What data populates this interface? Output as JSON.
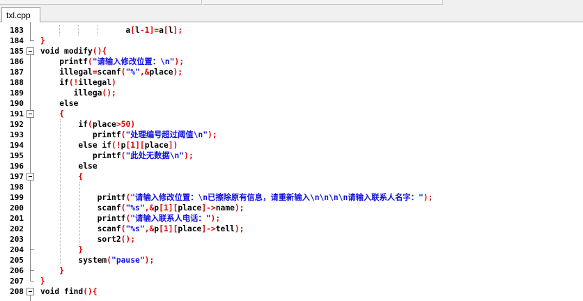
{
  "tab": {
    "label": "txl.cpp"
  },
  "lines": [
    {
      "n": "183",
      "parts": [
        [
          "",
          "                  a"
        ],
        [
          "op",
          "["
        ],
        [
          "",
          "l"
        ],
        [
          "op",
          "-"
        ],
        [
          "num",
          "1"
        ],
        [
          "op",
          "]="
        ],
        [
          "",
          "a"
        ],
        [
          "op",
          "["
        ],
        [
          "",
          "l"
        ],
        [
          "op",
          "];"
        ]
      ]
    },
    {
      "n": "184",
      "parts": [
        [
          "br",
          "}"
        ]
      ]
    },
    {
      "n": "185",
      "parts": [
        [
          "kw",
          "void "
        ],
        [
          "",
          "modify"
        ],
        [
          "op",
          "(){"
        ]
      ]
    },
    {
      "n": "186",
      "parts": [
        [
          "",
          "    printf"
        ],
        [
          "op",
          "("
        ],
        [
          "str",
          "\"请输入修改位置：\\n\""
        ],
        [
          "op",
          ");"
        ]
      ]
    },
    {
      "n": "187",
      "parts": [
        [
          "",
          "    illegal"
        ],
        [
          "op",
          "="
        ],
        [
          "",
          "scanf"
        ],
        [
          "op",
          "("
        ],
        [
          "str",
          "\"%\""
        ],
        [
          "op",
          ",&"
        ],
        [
          "",
          "place"
        ],
        [
          "op",
          ");"
        ]
      ]
    },
    {
      "n": "188",
      "parts": [
        [
          "kw",
          "    if"
        ],
        [
          "op",
          "(!"
        ],
        [
          "",
          "illegal"
        ],
        [
          "op",
          ")"
        ]
      ]
    },
    {
      "n": "189",
      "parts": [
        [
          "",
          "       illega"
        ],
        [
          "op",
          "();"
        ]
      ]
    },
    {
      "n": "190",
      "parts": [
        [
          "kw",
          "    else"
        ]
      ]
    },
    {
      "n": "191",
      "parts": [
        [
          "br",
          "    {"
        ]
      ]
    },
    {
      "n": "192",
      "parts": [
        [
          "kw",
          "        if"
        ],
        [
          "op",
          "("
        ],
        [
          "",
          "place"
        ],
        [
          "op",
          ">"
        ],
        [
          "num",
          "50"
        ],
        [
          "op",
          ")"
        ]
      ]
    },
    {
      "n": "193",
      "parts": [
        [
          "",
          "           printf"
        ],
        [
          "op",
          "("
        ],
        [
          "str",
          "\"处理编号超过阈值\\n\""
        ],
        [
          "op",
          ");"
        ]
      ]
    },
    {
      "n": "194",
      "parts": [
        [
          "kw",
          "        else if"
        ],
        [
          "op",
          "(!"
        ],
        [
          "",
          "p"
        ],
        [
          "op",
          "["
        ],
        [
          "num",
          "1"
        ],
        [
          "op",
          "]["
        ],
        [
          "",
          "place"
        ],
        [
          "op",
          "])"
        ]
      ]
    },
    {
      "n": "195",
      "parts": [
        [
          "",
          "           printf"
        ],
        [
          "op",
          "("
        ],
        [
          "str",
          "\"此处无数据\\n\""
        ],
        [
          "op",
          ");"
        ]
      ]
    },
    {
      "n": "196",
      "parts": [
        [
          "kw",
          "        else"
        ]
      ]
    },
    {
      "n": "197",
      "parts": [
        [
          "br",
          "        {"
        ]
      ]
    },
    {
      "n": "198",
      "parts": [
        [
          "",
          ""
        ]
      ]
    },
    {
      "n": "199",
      "parts": [
        [
          "",
          "            printf"
        ],
        [
          "op",
          "("
        ],
        [
          "str",
          "\"请输入修改位置：\\n已擦除原有信息，请重新输入\\n\\n\\n\\n请输入联系人名字：\""
        ],
        [
          "op",
          ");"
        ]
      ]
    },
    {
      "n": "200",
      "parts": [
        [
          "",
          "            scanf"
        ],
        [
          "op",
          "("
        ],
        [
          "str",
          "\"%s\""
        ],
        [
          "op",
          ",&"
        ],
        [
          "",
          "p"
        ],
        [
          "op",
          "["
        ],
        [
          "num",
          "1"
        ],
        [
          "op",
          "]["
        ],
        [
          "",
          "place"
        ],
        [
          "op",
          "]->"
        ],
        [
          "",
          "name"
        ],
        [
          "op",
          ");"
        ]
      ]
    },
    {
      "n": "201",
      "parts": [
        [
          "",
          "            printf"
        ],
        [
          "op",
          "("
        ],
        [
          "str",
          "\"请输入联系人电话：\""
        ],
        [
          "op",
          ");"
        ]
      ]
    },
    {
      "n": "202",
      "parts": [
        [
          "",
          "            scanf"
        ],
        [
          "op",
          "("
        ],
        [
          "str",
          "\"%s\""
        ],
        [
          "op",
          ",&"
        ],
        [
          "",
          "p"
        ],
        [
          "op",
          "["
        ],
        [
          "num",
          "1"
        ],
        [
          "op",
          "]["
        ],
        [
          "",
          "place"
        ],
        [
          "op",
          "]->"
        ],
        [
          "",
          "tell"
        ],
        [
          "op",
          ");"
        ]
      ]
    },
    {
      "n": "203",
      "parts": [
        [
          "",
          "            sort2"
        ],
        [
          "op",
          "();"
        ]
      ]
    },
    {
      "n": "204",
      "parts": [
        [
          "br",
          "        }"
        ]
      ]
    },
    {
      "n": "205",
      "parts": [
        [
          "",
          "        system"
        ],
        [
          "op",
          "("
        ],
        [
          "str",
          "\"pause\""
        ],
        [
          "op",
          ");"
        ]
      ]
    },
    {
      "n": "206",
      "parts": [
        [
          "br",
          "    }"
        ]
      ]
    },
    {
      "n": "207",
      "parts": [
        [
          "br",
          "}"
        ]
      ]
    },
    {
      "n": "208",
      "parts": [
        [
          "kw",
          "void "
        ],
        [
          "",
          "find"
        ],
        [
          "op",
          "(){"
        ]
      ]
    }
  ]
}
